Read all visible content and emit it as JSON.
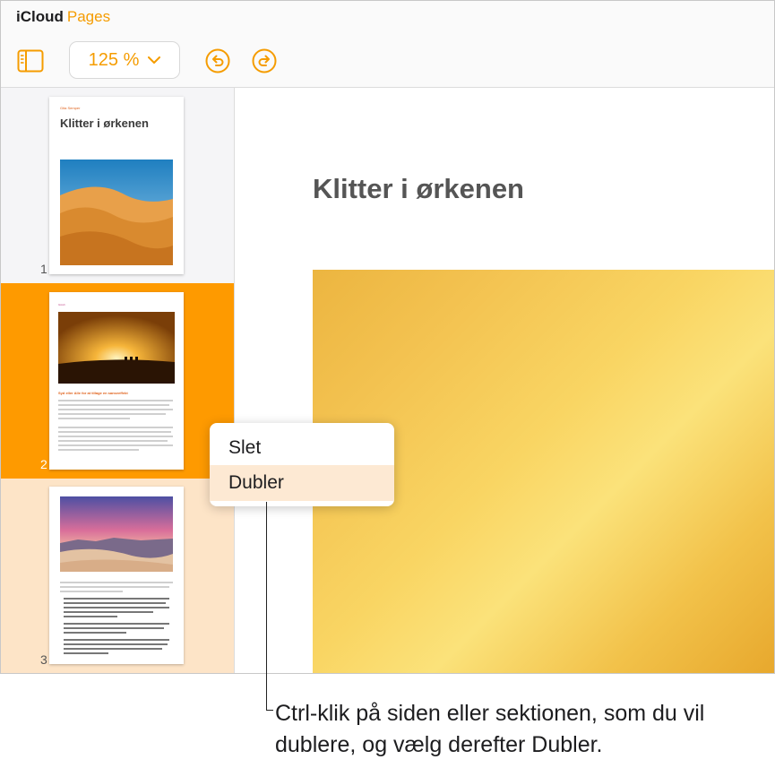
{
  "app": {
    "brand": "iCloud",
    "product": "Pages"
  },
  "toolbar": {
    "sidebar_icon": "sidebar-toggle-icon",
    "zoom": "125 %",
    "undo_icon": "undo-icon",
    "redo_icon": "redo-icon",
    "accent": "#f59c00"
  },
  "thumbnails": [
    {
      "number": "1",
      "author": "Gita Semper",
      "title": "Klitter i ørkenen"
    },
    {
      "number": "2",
      "section": "Gizeh",
      "heading": "Syd eller Alle for at tillage en sanseeffekt"
    },
    {
      "number": "3"
    }
  ],
  "document": {
    "title": "Klitter i ørkenen"
  },
  "context_menu": {
    "items": [
      "Slet",
      "Dubler"
    ]
  },
  "caption": "Ctrl-klik på siden eller sektionen, som du vil dublere, og vælg derefter Dubler.",
  "colors": {
    "selected_row": "#fe9a00",
    "highlight_row": "#fde4c7",
    "menu_highlight": "#fde9d3"
  }
}
